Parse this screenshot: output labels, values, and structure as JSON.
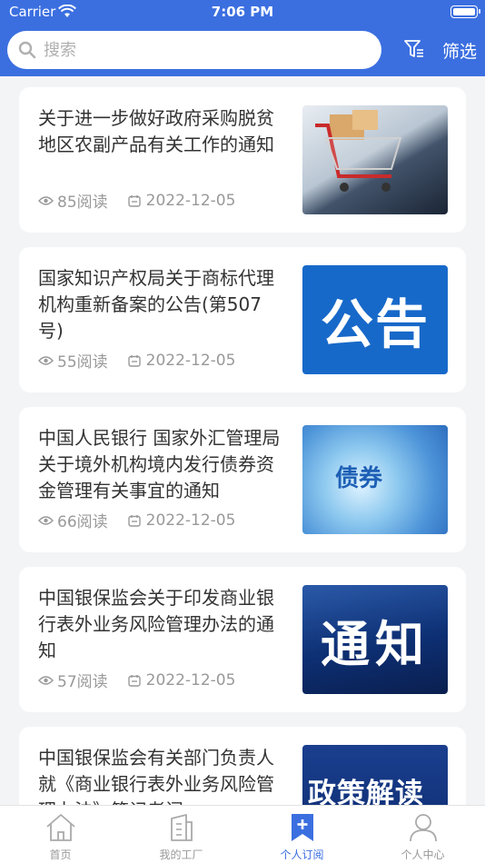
{
  "status": {
    "carrier": "Carrier",
    "time": "7:06 PM"
  },
  "search": {
    "placeholder": "搜索",
    "value": ""
  },
  "filter": {
    "label": "筛选"
  },
  "colors": {
    "accent": "#3b6fe0",
    "muted": "#999999",
    "text": "#333333"
  },
  "articles": [
    {
      "title": "关于进一步做好政府采购脱贫地区农副产品有关工作的通知",
      "reads": "85阅读",
      "date": "2022-12-05",
      "thumb": "shopping-cart-image",
      "thumb_text": ""
    },
    {
      "title": "国家知识产权局关于商标代理机构重新备案的公告(第507号)",
      "reads": "55阅读",
      "date": "2022-12-05",
      "thumb": "notice-image",
      "thumb_text": "公告"
    },
    {
      "title": "中国人民银行 国家外汇管理局关于境外机构境内发行债券资金管理有关事宜的通知",
      "reads": "66阅读",
      "date": "2022-12-05",
      "thumb": "bond-image",
      "thumb_text": "债券"
    },
    {
      "title": "中国银保监会关于印发商业银行表外业务风险管理办法的通知",
      "reads": "57阅读",
      "date": "2022-12-05",
      "thumb": "tongzhi-image",
      "thumb_text": "通知"
    },
    {
      "title": "中国银保监会有关部门负责人就《商业银行表外业务风险管理办法》答记者问",
      "reads": "",
      "date": "",
      "thumb": "policy-image",
      "thumb_text": "政策解读"
    }
  ],
  "tabs": [
    {
      "label": "首页",
      "icon": "home-icon"
    },
    {
      "label": "我的工厂",
      "icon": "factory-icon"
    },
    {
      "label": "个人订阅",
      "icon": "bookmark-plus-icon",
      "active": true
    },
    {
      "label": "个人中心",
      "icon": "person-icon"
    }
  ]
}
